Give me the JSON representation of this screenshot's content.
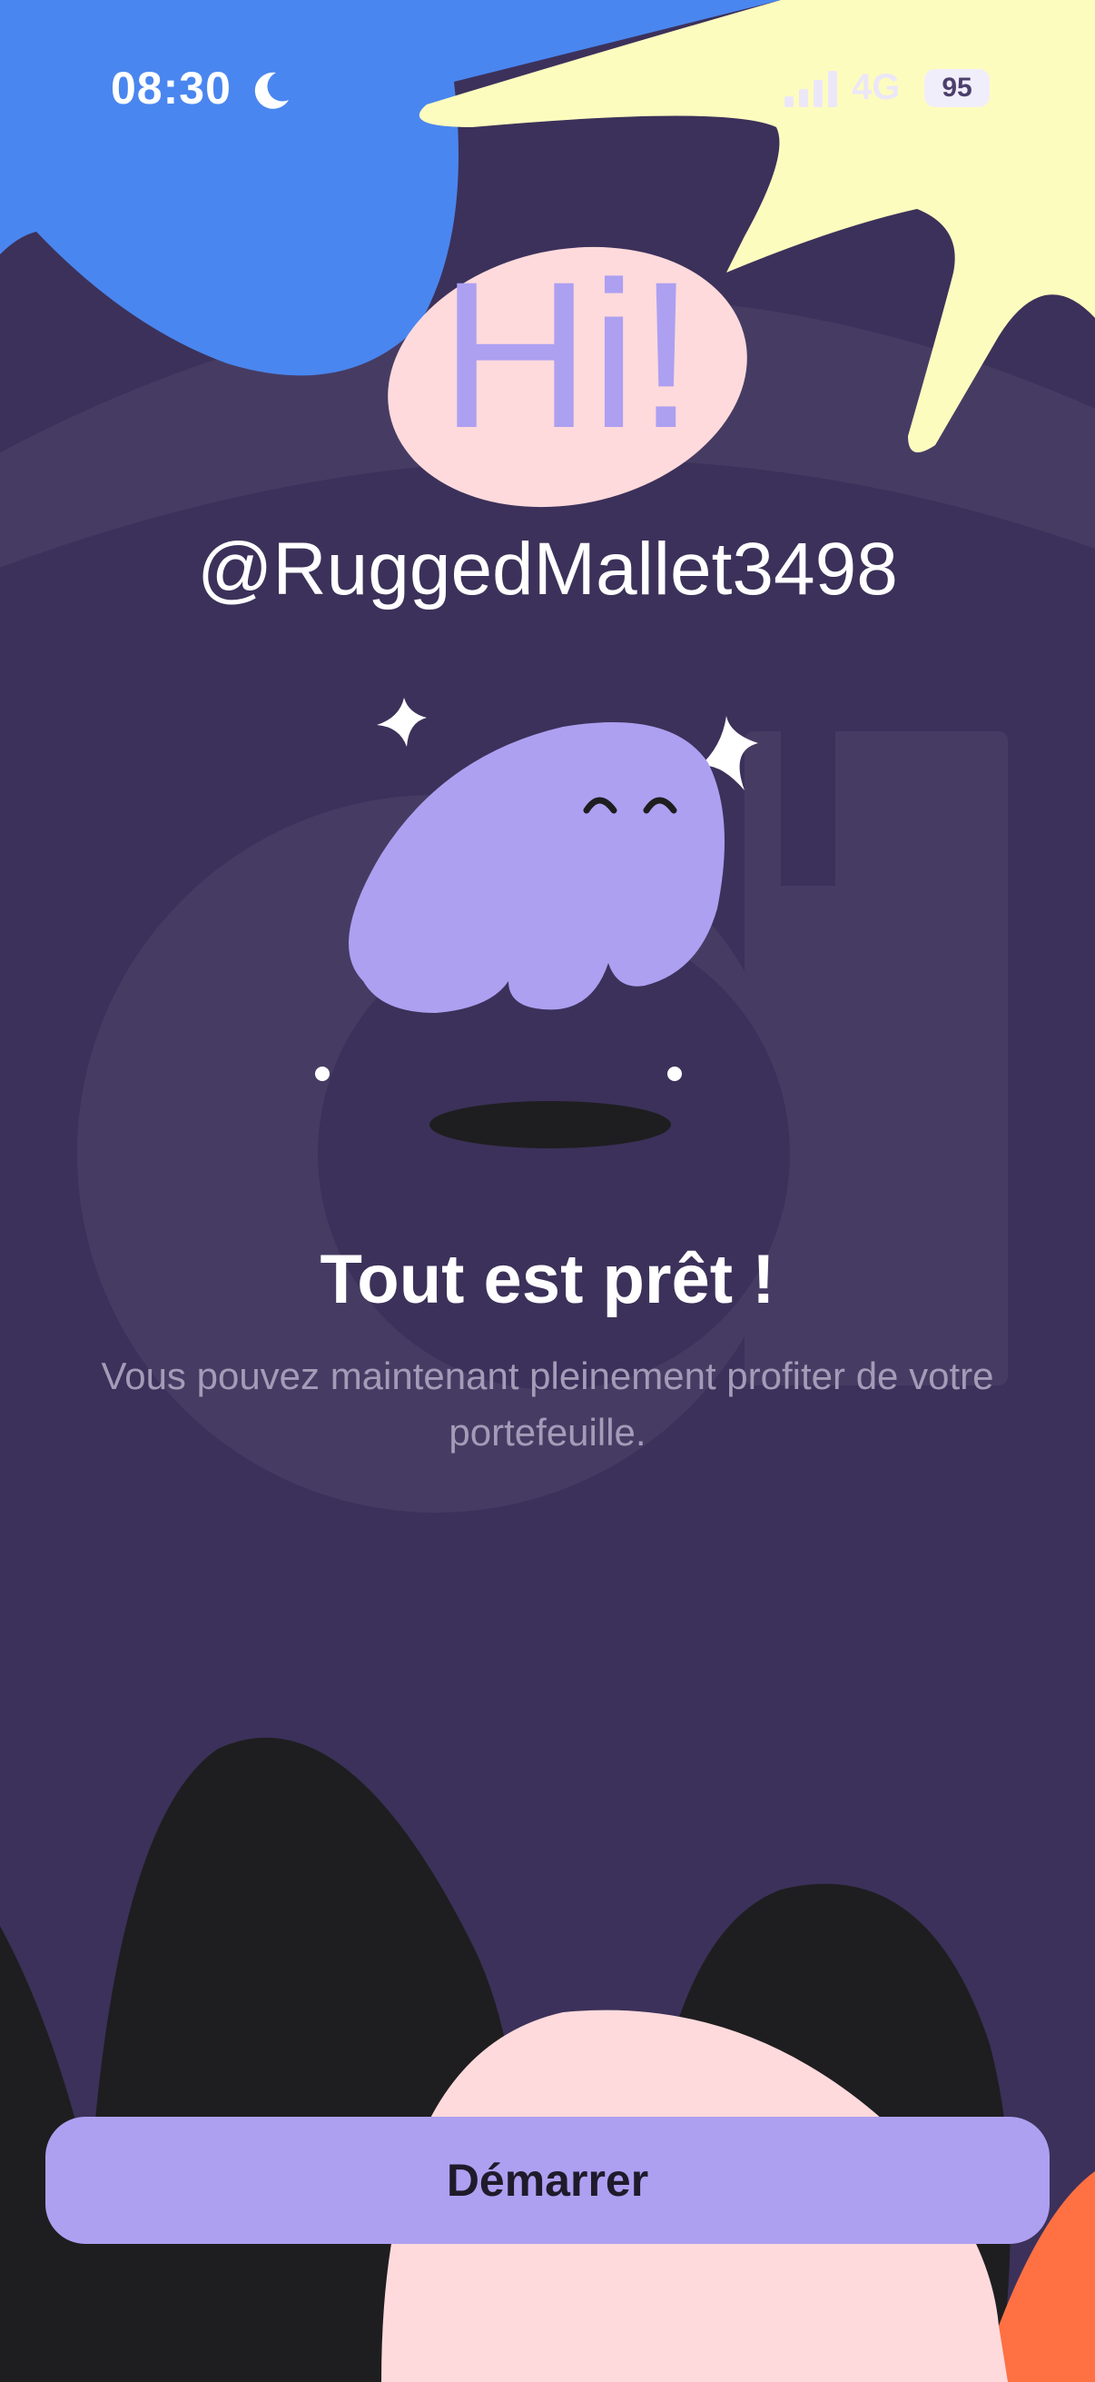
{
  "status_bar": {
    "time": "08:30",
    "network": "4G",
    "battery": "95"
  },
  "hero": {
    "greeting": "Hi!",
    "username": "@RuggedMallet3498"
  },
  "message": {
    "title": "Tout est prêt !",
    "subtitle": "Vous pouvez maintenant pleinement profiter de votre portefeuille."
  },
  "cta": {
    "label": "Démarrer"
  },
  "colors": {
    "background": "#3c315a",
    "accent_purple": "#ada0f1",
    "blue_blob": "#4a86ef",
    "yellow_blob": "#fdfcbf",
    "pink_blob": "#ffdadc",
    "orange_blob": "#ff7043"
  }
}
